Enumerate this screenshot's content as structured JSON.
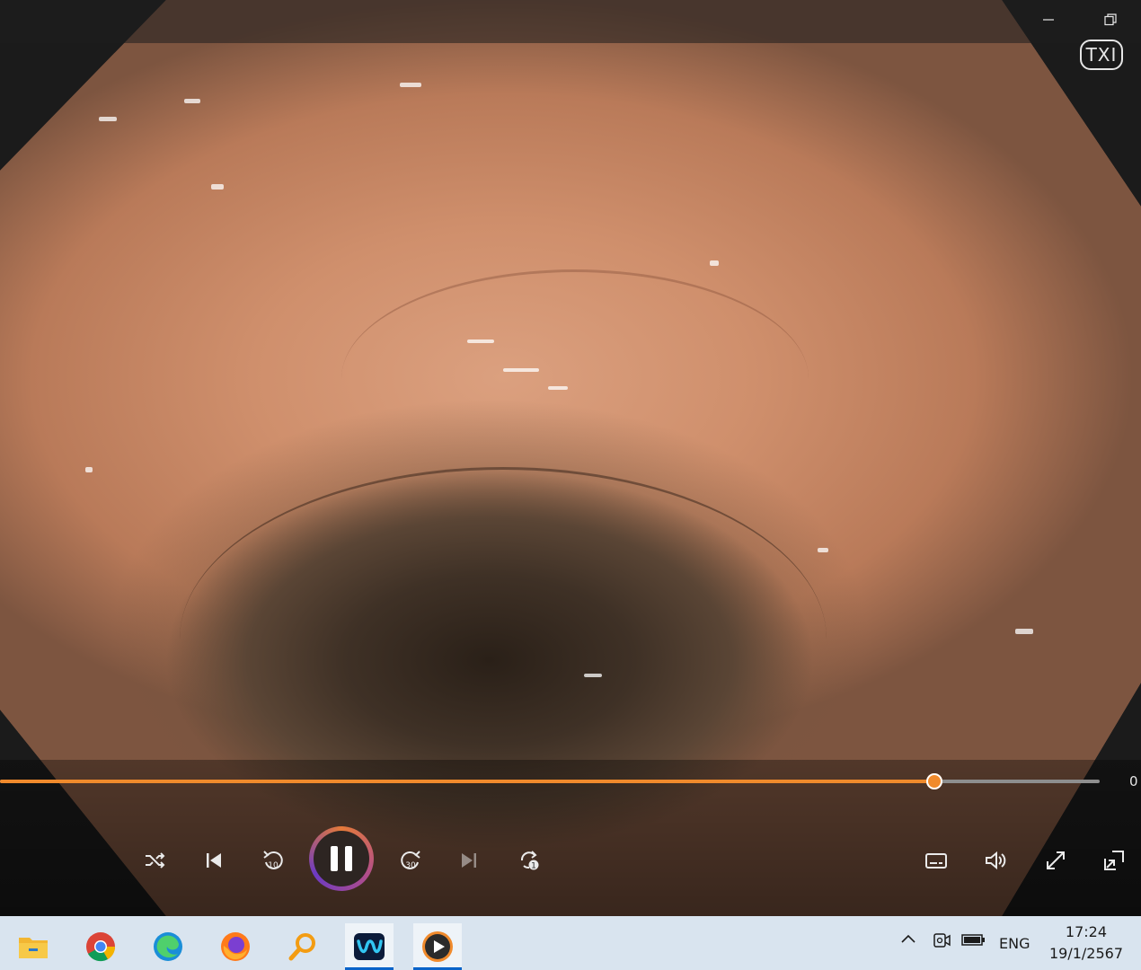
{
  "window": {
    "minimize_icon": "minimize-icon",
    "restore_icon": "restore-icon",
    "badge_text": "TXI"
  },
  "player": {
    "progress": 0.85,
    "time_text": "0",
    "accent_color": "#f08a2c",
    "state": "playing",
    "controls": {
      "shuffle": "shuffle-icon",
      "previous": "previous-track-icon",
      "rewind_10_label": "10",
      "pause": "pause-icon",
      "forward_30_label": "30",
      "next": "next-track-icon",
      "repeat_label": "1",
      "captions": "captions-icon",
      "volume": "volume-icon",
      "fullscreen": "fullscreen-icon",
      "miniplayer": "miniplayer-icon"
    }
  },
  "taskbar": {
    "apps": [
      {
        "name": "file-explorer-icon"
      },
      {
        "name": "chrome-icon"
      },
      {
        "name": "edge-icon"
      },
      {
        "name": "firefox-icon"
      },
      {
        "name": "search-magnifier-icon"
      },
      {
        "name": "webex-icon",
        "active": true
      },
      {
        "name": "media-player-icon",
        "active": true
      }
    ],
    "tray": {
      "chevron": "chevron-up-icon",
      "meet": "meet-now-icon",
      "battery": "battery-icon",
      "language": "ENG"
    },
    "clock": {
      "time": "17:24",
      "date": "19/1/2567"
    }
  }
}
